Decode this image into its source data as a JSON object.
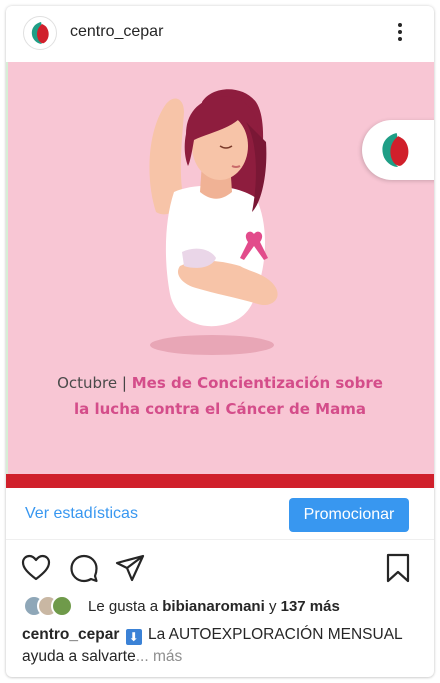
{
  "header": {
    "username": "centro_cepar",
    "avatar_icon": "cepar-logo-icon",
    "more_icon": "more-vertical-icon"
  },
  "post_image": {
    "month_label": "Octubre",
    "separator": "|",
    "line1_accent": "Mes de Concientización sobre",
    "line2": "la lucha contra el Cáncer de Mama",
    "illustration_icon": "woman-self-exam-illustration",
    "ribbon_icon": "pink-ribbon-icon",
    "corner_logo_icon": "cepar-logo-icon"
  },
  "insights": {
    "stats_label": "Ver estadísticas",
    "promote_label": "Promocionar"
  },
  "actions": {
    "like_icon": "heart-icon",
    "comment_icon": "comment-icon",
    "share_icon": "send-icon",
    "save_icon": "bookmark-icon"
  },
  "likes": {
    "prefix": "Le gusta a",
    "user": "bibianaromani",
    "connector": "y",
    "others": "137 más"
  },
  "caption": {
    "user": "centro_cepar",
    "badge": "⬇",
    "text": "La AUTOEXPLORACIÓN MENSUAL ayuda a salvarte",
    "ellipsis": "...",
    "more": "más"
  },
  "colors": {
    "accent_blue": "#3897f0",
    "image_background": "#f8c6d4",
    "brand_pink": "#d44d8a",
    "brand_red": "#d0202b"
  }
}
